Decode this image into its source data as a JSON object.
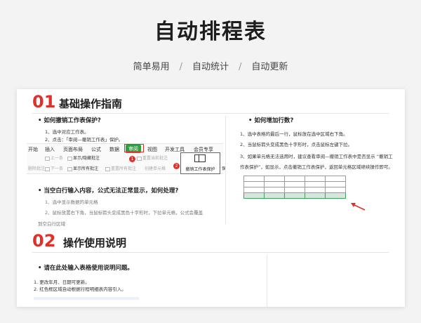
{
  "header": {
    "title": "自动排程表",
    "subtitle": [
      "简单易用",
      "自动统计",
      "自动更新"
    ],
    "separator": "/"
  },
  "section1": {
    "number": "01",
    "title": "基础操作指南",
    "left": {
      "q1": "如何撤销工作表保护?",
      "steps": [
        "1、选中对应工作表。",
        "2、点击：「审阅—撤销工作表」保护。"
      ],
      "ribbon": {
        "tabs": [
          "开始",
          "插入",
          "页面布局",
          "公式",
          "数据",
          "审阅",
          "视图",
          "开发工具",
          "会员专享"
        ],
        "buttons_row1": [
          "上一条",
          "显示/隐藏批注",
          "重置当前批注"
        ],
        "buttons_row2": [
          "删除批注",
          "下一条",
          "显示所有批注",
          "重置所有批注",
          "创建单元格"
        ],
        "protect_label": "撤销工作表保护",
        "protect_trailing": "保",
        "badge1": "1",
        "badge2": "2"
      },
      "q2": "当空白行输入内容，公式无法正常显示，如何处理?",
      "steps2": [
        "1、选中显示数据的单元格",
        "2、鼠标放置右下角，当鼠标箭头变成黑色十字形时，下拉单元格，公式会覆盖",
        "到空白行区域"
      ]
    },
    "right": {
      "q": "如何增加行数?",
      "steps": [
        "1、选中表格的最后一行，鼠标放在选中区域右下角。",
        "2、当鼠标箭头变成黑色十字形时，点击鼠标左键下拉。",
        "3、如果单元格无法选用时，建议查看审阅—撤销工作表中是否显示 “撤销工",
        "作表保护”，如显示，点击撤销工作表保护，返回单元格区域继续操作即可。"
      ]
    }
  },
  "section2": {
    "number": "02",
    "title": "操作使用说明",
    "q": "请在此处输入表格使用说明问题。",
    "steps": [
      "1. 更改年月、日期可更新。",
      "2. 红色框区域自动根据行程明细表内容引入。"
    ]
  },
  "colors": {
    "accent_red": "#e0302a",
    "accent_green": "#29a33a"
  }
}
